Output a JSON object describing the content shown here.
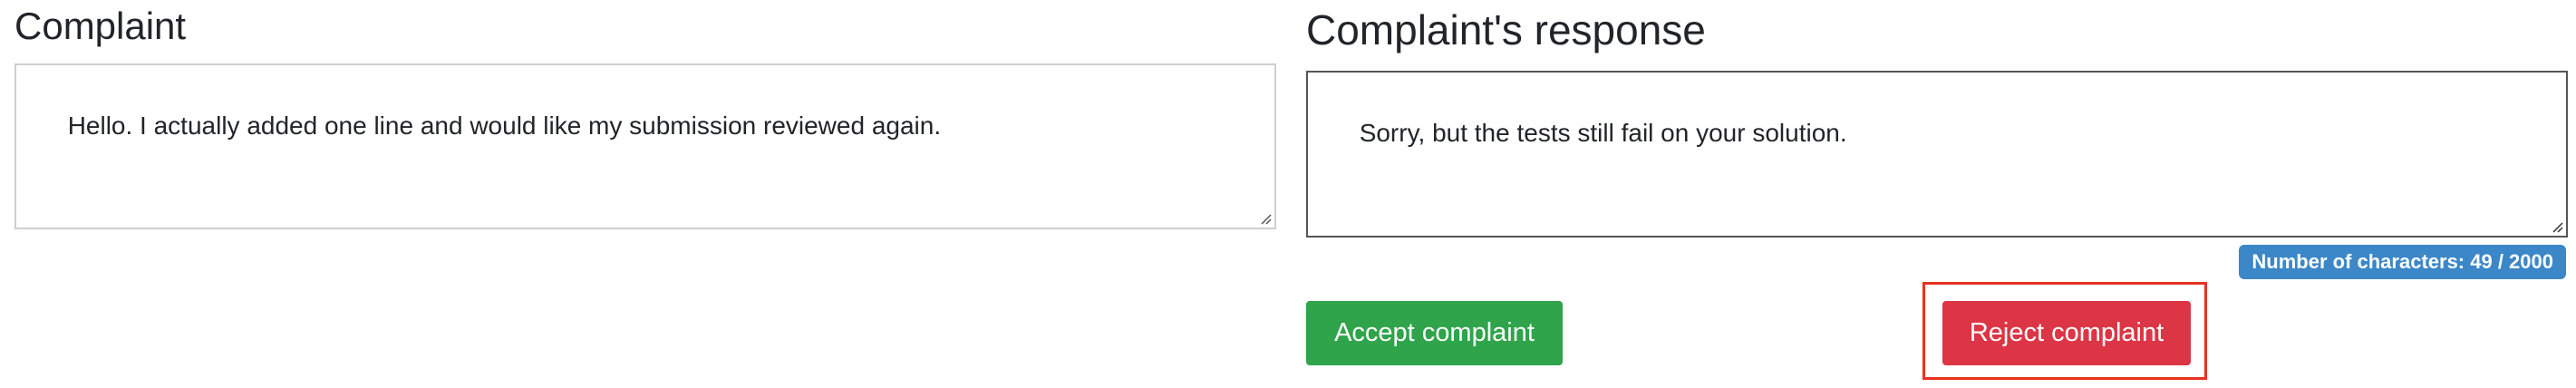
{
  "complaint": {
    "title": "Complaint",
    "text": "Hello. I actually added one line and would like my submission reviewed again."
  },
  "response": {
    "title": "Complaint's response",
    "text": "Sorry, but the tests still fail on your solution.",
    "char_count_label": "Number of characters: 49 / 2000"
  },
  "actions": {
    "accept_label": "Accept complaint",
    "reject_label": "Reject complaint"
  },
  "colors": {
    "accept": "#2fa44a",
    "reject": "#dc3545",
    "badge": "#3b87c8",
    "highlight": "#e8321f"
  }
}
